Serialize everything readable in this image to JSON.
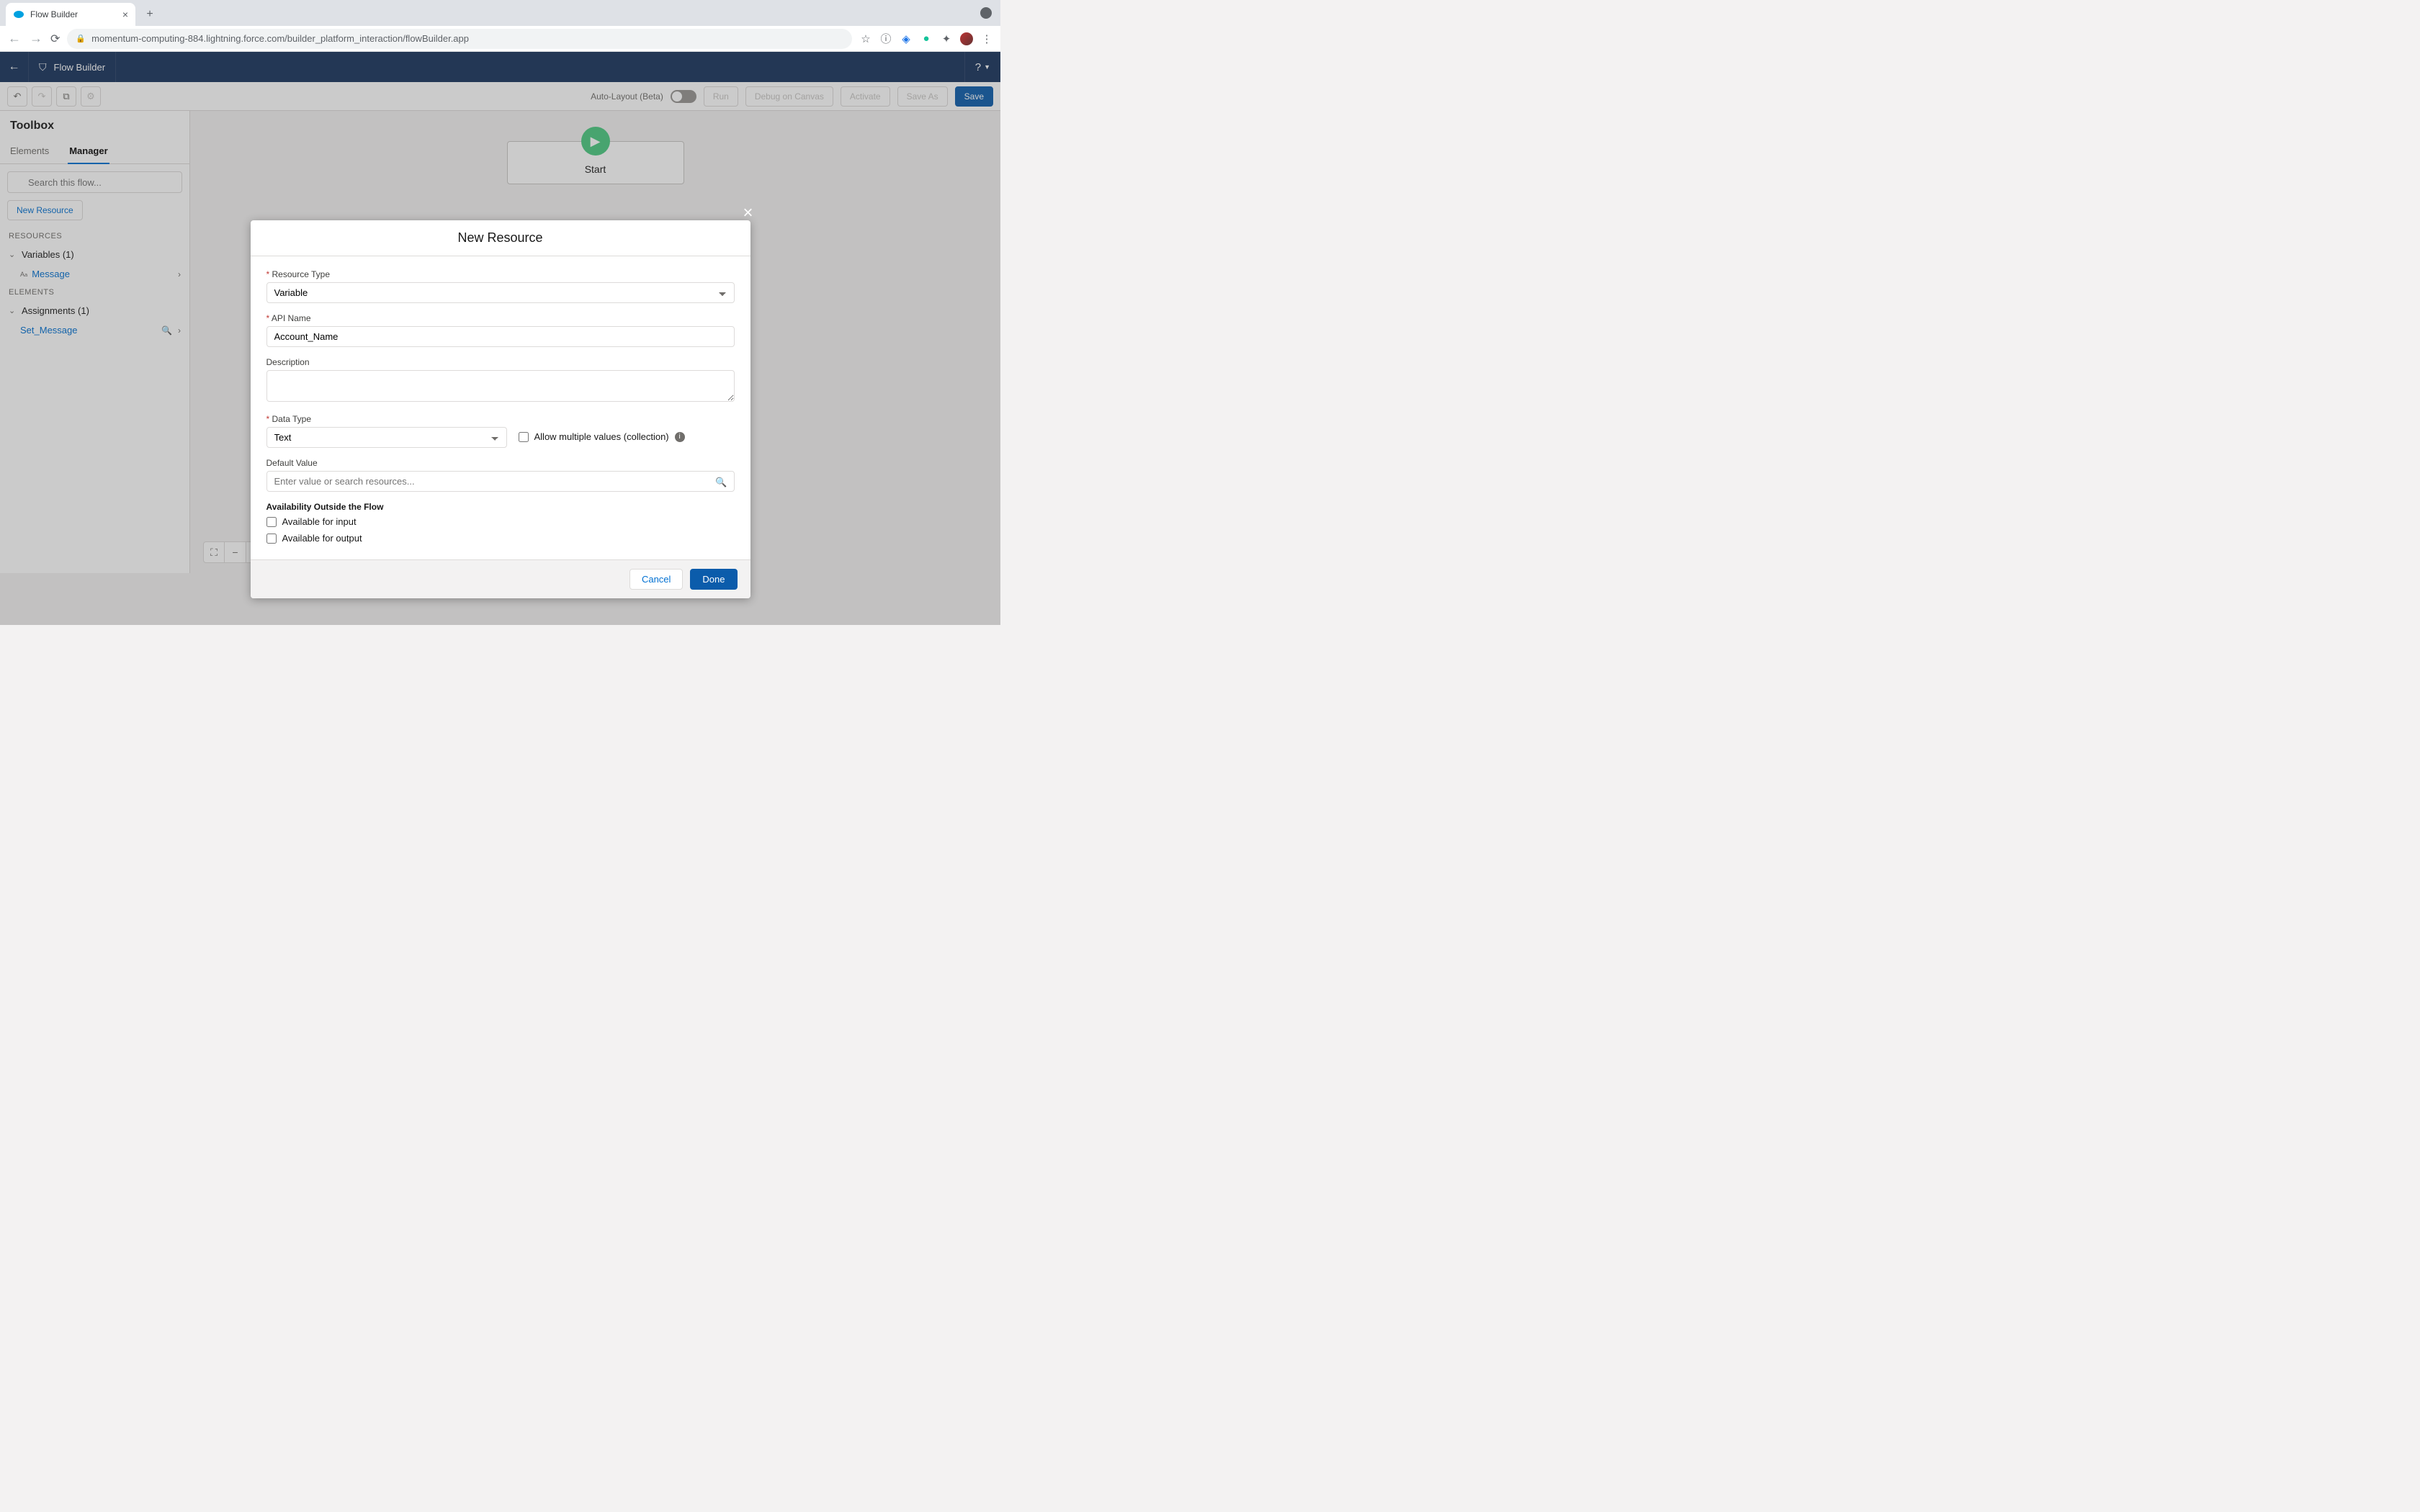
{
  "browser": {
    "tab_title": "Flow Builder",
    "url": "momentum-computing-884.lightning.force.com/builder_platform_interaction/flowBuilder.app"
  },
  "header": {
    "app_title": "Flow Builder",
    "help": "?"
  },
  "toolbar": {
    "auto_layout_label": "Auto-Layout (Beta)",
    "run": "Run",
    "debug_on_canvas": "Debug on Canvas",
    "activate": "Activate",
    "save_as": "Save As",
    "save": "Save"
  },
  "sidebar": {
    "title": "Toolbox",
    "tabs": {
      "elements": "Elements",
      "manager": "Manager"
    },
    "search_placeholder": "Search this flow...",
    "new_resource_btn": "New Resource",
    "resources_label": "RESOURCES",
    "elements_label": "ELEMENTS",
    "variables_group": "Variables (1)",
    "variable_item": "Message",
    "assignments_group": "Assignments (1)",
    "assignment_item": "Set_Message"
  },
  "canvas": {
    "start_label": "Start"
  },
  "modal": {
    "title": "New Resource",
    "resource_type_label": "Resource Type",
    "resource_type_value": "Variable",
    "api_name_label": "API Name",
    "api_name_value": "Account_Name",
    "description_label": "Description",
    "description_value": "",
    "data_type_label": "Data Type",
    "data_type_value": "Text",
    "allow_multiple_label": "Allow multiple values (collection)",
    "default_value_label": "Default Value",
    "default_value_placeholder": "Enter value or search resources...",
    "availability_heading": "Availability Outside the Flow",
    "available_input_label": "Available for input",
    "available_output_label": "Available for output",
    "cancel": "Cancel",
    "done": "Done"
  }
}
